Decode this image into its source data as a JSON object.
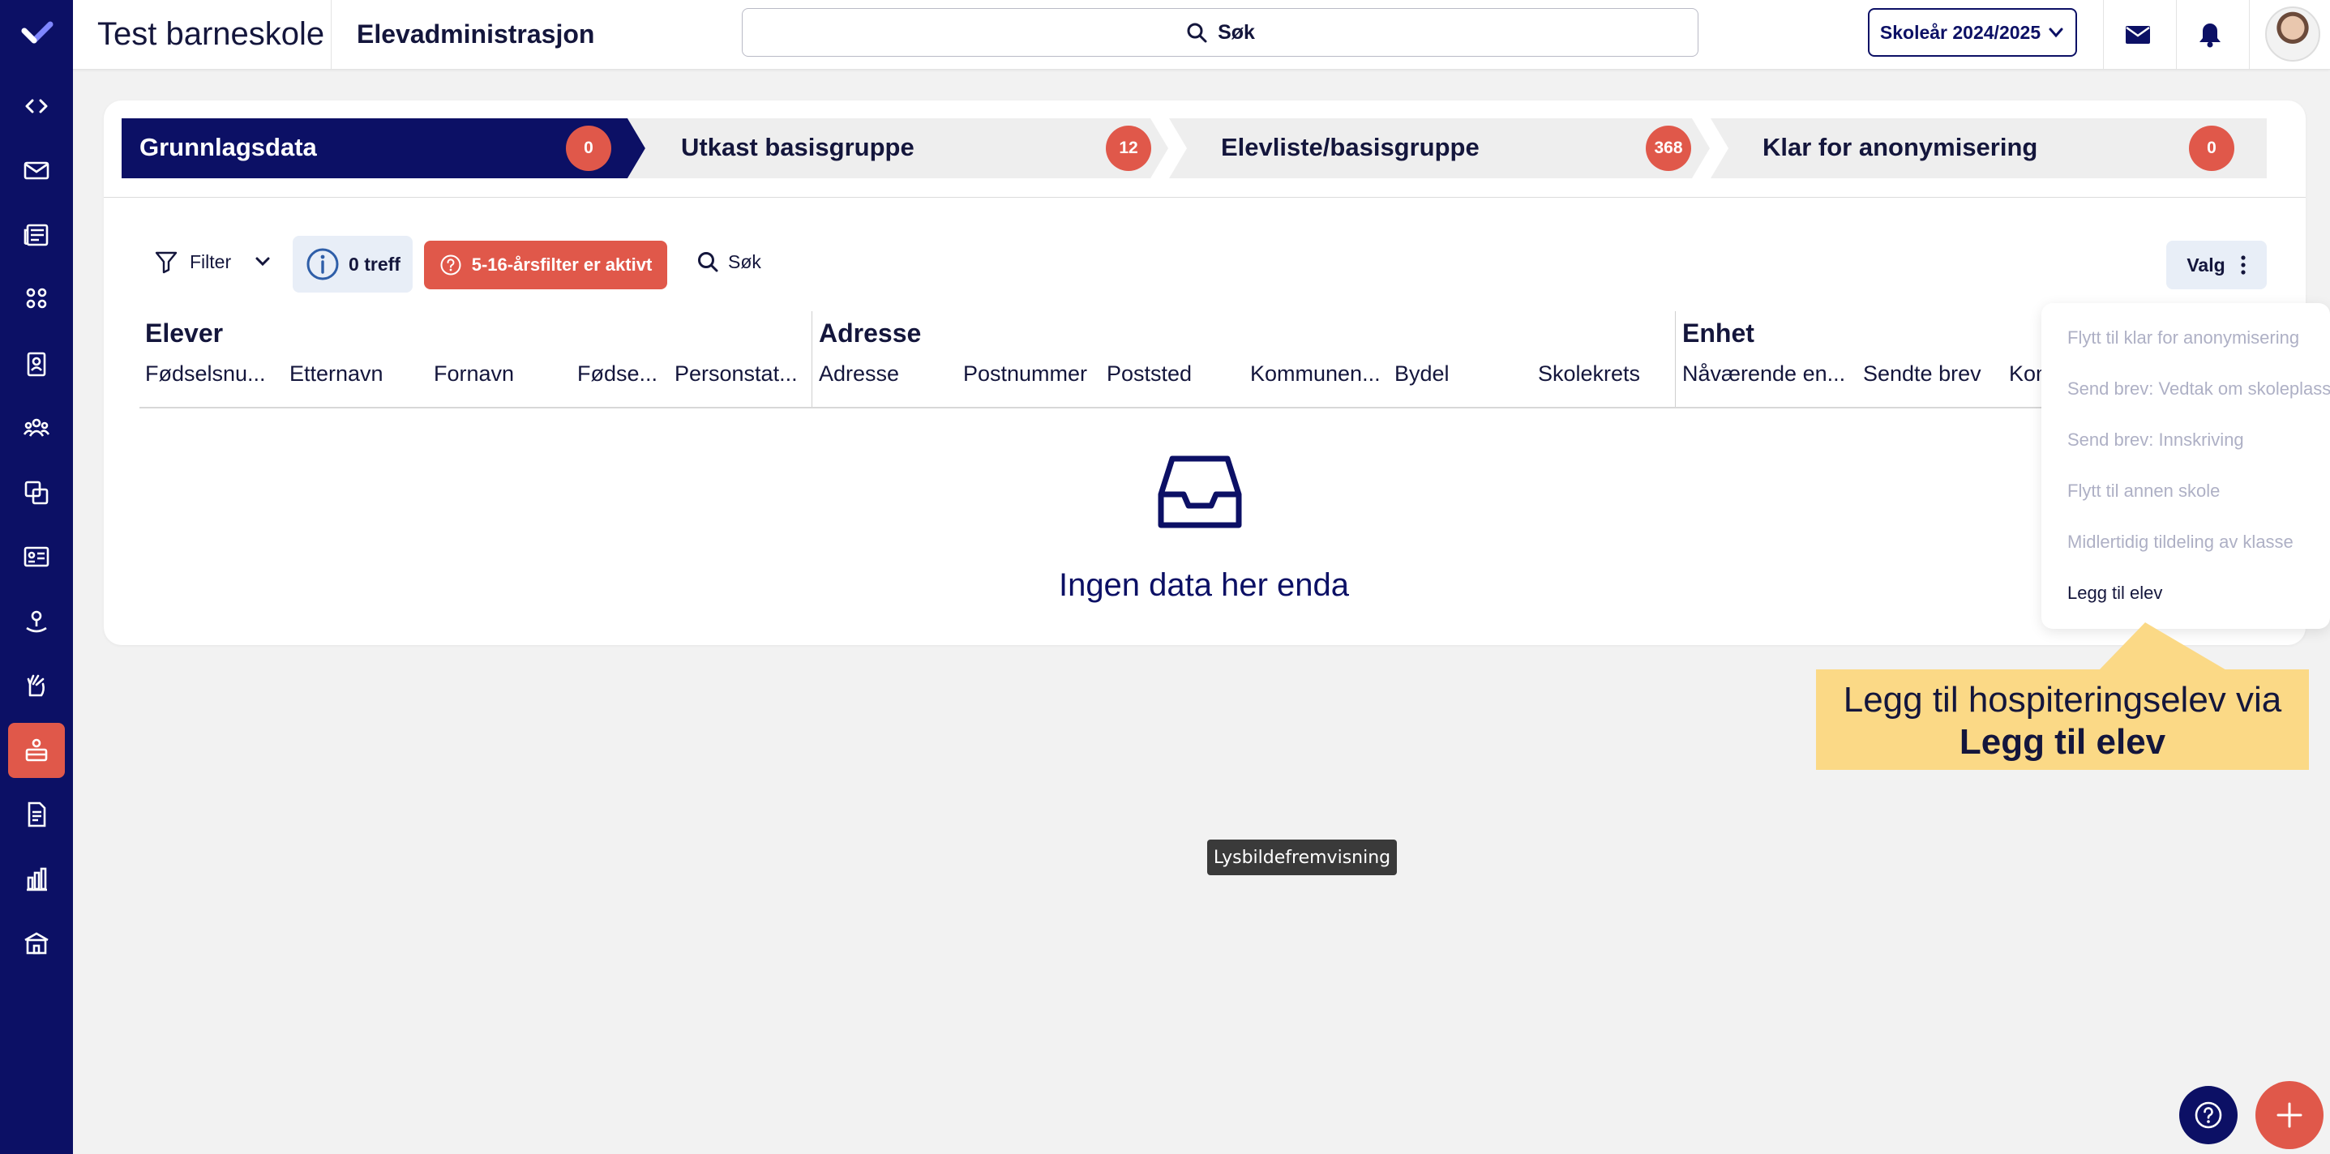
{
  "app": {
    "school_name": "Test barneskole",
    "module_title": "Elevadministrasjon",
    "search_label": "Søk",
    "school_year": "Skoleår 2024/2025"
  },
  "colors": {
    "navy": "#0c1065",
    "accent_red": "#e0584a",
    "callout_yellow": "#fbd986"
  },
  "rail_icons": [
    "code-icon",
    "mail-icon",
    "news-icon",
    "groups-icon",
    "badge-icon",
    "people-icon",
    "exchange-icon",
    "id-card-icon",
    "person-pin-icon",
    "hand-icon",
    "student-admin-icon",
    "document-icon",
    "bar-chart-icon",
    "school-icon"
  ],
  "steps": [
    {
      "label": "Grunnlagsdata",
      "count": "0",
      "active": true
    },
    {
      "label": "Utkast basisgruppe",
      "count": "12",
      "active": false
    },
    {
      "label": "Elevliste/basisgruppe",
      "count": "368",
      "active": false
    },
    {
      "label": "Klar for anonymisering",
      "count": "0",
      "active": false
    }
  ],
  "toolbar": {
    "filter_label": "Filter",
    "hits_label": "0 treff",
    "age_filter_label": "5-16-årsfilter er aktivt",
    "search_label": "Søk",
    "options_label": "Valg"
  },
  "table": {
    "groups": [
      "Elever",
      "Adresse",
      "Enhet"
    ],
    "columns": [
      "Fødselsnu...",
      "Etternavn",
      "Fornavn",
      "Fødse...",
      "Personstat...",
      "Adresse",
      "Postnummer",
      "Poststed",
      "Kommunen...",
      "Bydel",
      "Skolekrets",
      "Nåværende en...",
      "Sendte brev",
      "Kom"
    ]
  },
  "empty_state": {
    "message": "Ingen data her enda"
  },
  "options_menu": {
    "items": [
      {
        "label": "Flytt til klar for anonymisering",
        "enabled": false
      },
      {
        "label": "Send brev: Vedtak om skoleplass",
        "enabled": false
      },
      {
        "label": "Send brev: Innskriving",
        "enabled": false
      },
      {
        "label": "Flytt til annen skole",
        "enabled": false
      },
      {
        "label": "Midlertidig tildeling av klasse",
        "enabled": false
      },
      {
        "label": "Legg til elev",
        "enabled": true
      }
    ]
  },
  "callout": {
    "line1": "Legg til hospiteringselev via",
    "line2": "Legg til elev"
  },
  "slideshow_tooltip": "Lysbildefremvisning"
}
